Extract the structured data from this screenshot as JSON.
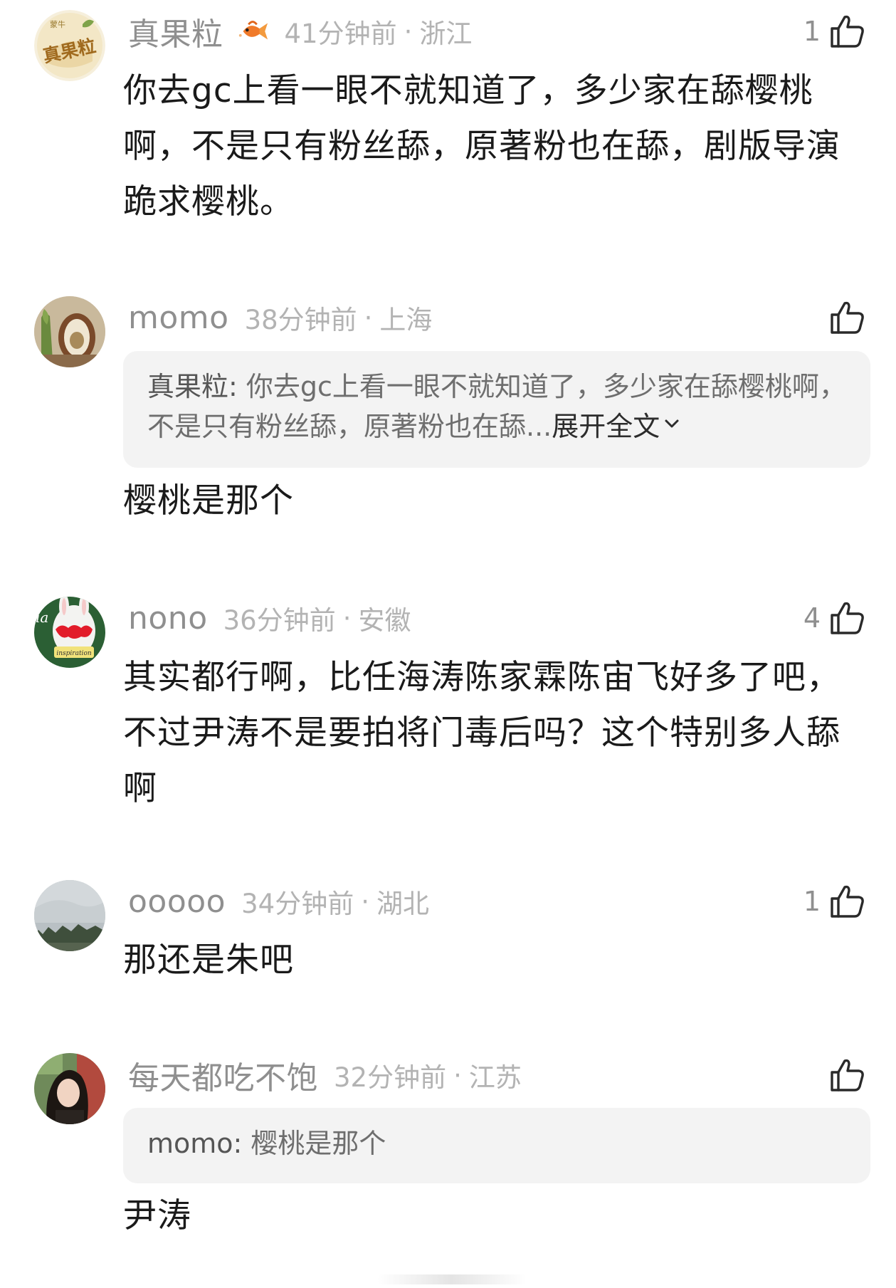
{
  "comments": [
    {
      "username": "真果粒",
      "time": "41分钟前",
      "location": "浙江",
      "likes": "1",
      "text": "你去gc上看一眼不就知道了，多少家在舔樱桃啊，不是只有粉丝舔，原著粉也在舔，剧版导演跪求樱桃。",
      "avatar_text": "真果粒",
      "avatar_small_text": "蒙牛"
    },
    {
      "username": "momo",
      "time": "38分钟前",
      "location": "上海",
      "likes": "",
      "quote_name": "真果粒:",
      "quote_text": " 你去gc上看一眼不就知道了，多少家在舔樱桃啊，不是只有粉丝舔，原著粉也在舔...",
      "quote_expand": "展开全文",
      "text": "樱桃是那个"
    },
    {
      "username": "nono",
      "time": "36分钟前",
      "location": "安徽",
      "likes": "4",
      "text": "其实都行啊，比任海涛陈家霖陈宙飞好多了吧，不过尹涛不是要拍将门毒后吗？这个特别多人舔啊",
      "avatar_text_1": "ia",
      "avatar_text_2": "inspiration"
    },
    {
      "username": "ooooo",
      "time": "34分钟前",
      "location": "湖北",
      "likes": "1",
      "text": "那还是朱吧"
    },
    {
      "username": "每天都吃不饱",
      "time": "32分钟前",
      "location": "江苏",
      "likes": "",
      "quote_name": "momo:",
      "quote_text": " 樱桃是那个",
      "text": "尹涛"
    }
  ],
  "separator": "·",
  "icons": {
    "like": "thumbs-up-icon",
    "fish": "goldfish-badge-icon",
    "expand": "chevron-down-icon"
  },
  "colors": {
    "username": "#8f8f8f",
    "meta": "#b3b3b3",
    "quote_bg": "#f3f3f3",
    "text": "#1a1a1a"
  }
}
